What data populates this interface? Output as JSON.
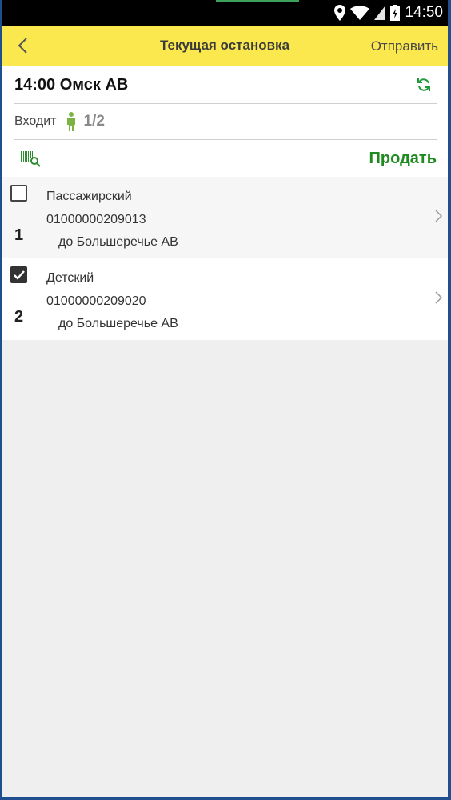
{
  "status_bar": {
    "time": "14:50"
  },
  "header": {
    "title": "Текущая остановка",
    "send_label": "Отправить"
  },
  "info": {
    "trip": "14:00 Омск АВ",
    "boarding_label": "Входит",
    "boarding_count": "1/2",
    "sell_label": "Продать"
  },
  "tickets": [
    {
      "number": "1",
      "type": "Пассажирский",
      "code": "01000000209013",
      "destination": "до Большеречье АВ",
      "checked": false
    },
    {
      "number": "2",
      "type": "Детский",
      "code": "01000000209020",
      "destination": "до Большеречье АВ",
      "checked": true
    }
  ],
  "colors": {
    "header_bg": "#fbe84e",
    "accent_green": "#1f8a1f",
    "page_bg": "#efefef"
  },
  "icons": [
    "location-icon",
    "wifi-icon",
    "signal-icon",
    "battery-icon",
    "back-icon",
    "refresh-icon",
    "person-icon",
    "barcode-search-icon",
    "chevron-right-icon",
    "checkbox-icon"
  ]
}
